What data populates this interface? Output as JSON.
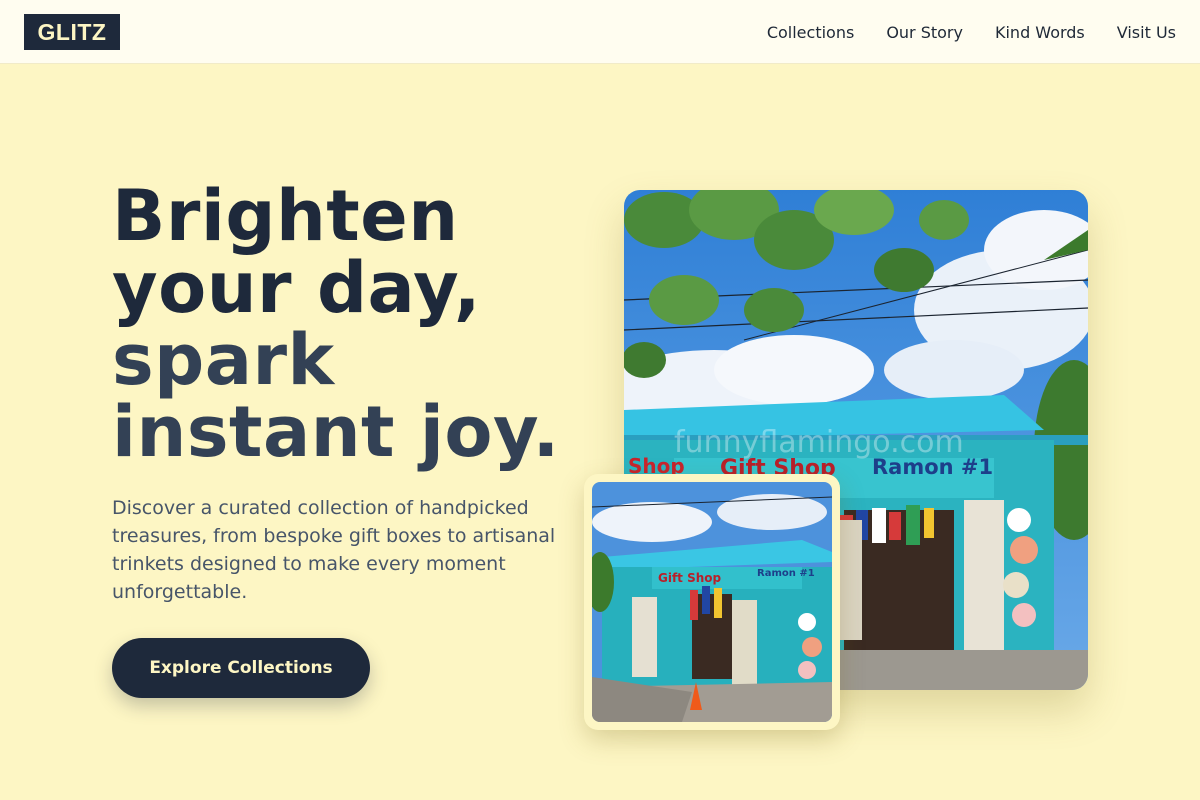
{
  "header": {
    "logo": "GLITZ",
    "nav": [
      "Collections",
      "Our Story",
      "Kind Words",
      "Visit Us"
    ]
  },
  "hero": {
    "title_lines": [
      "Brighten",
      "your day,",
      "spark",
      "instant joy."
    ],
    "description": "Discover a curated collection of handpicked treasures, from bespoke gift boxes to artisanal trinkets designed to make every moment unforgettable.",
    "cta_label": "Explore Collections"
  },
  "photo": {
    "sign_left": "Shop",
    "sign_center": "Gift Shop",
    "sign_right": "Ramon #1",
    "watermark": "funnyflamingo.com"
  },
  "colors": {
    "background": "#fdf6c4",
    "header_bg": "#fffdf0",
    "navy": "#1e293b",
    "shop_teal": "#2bb3c0"
  }
}
